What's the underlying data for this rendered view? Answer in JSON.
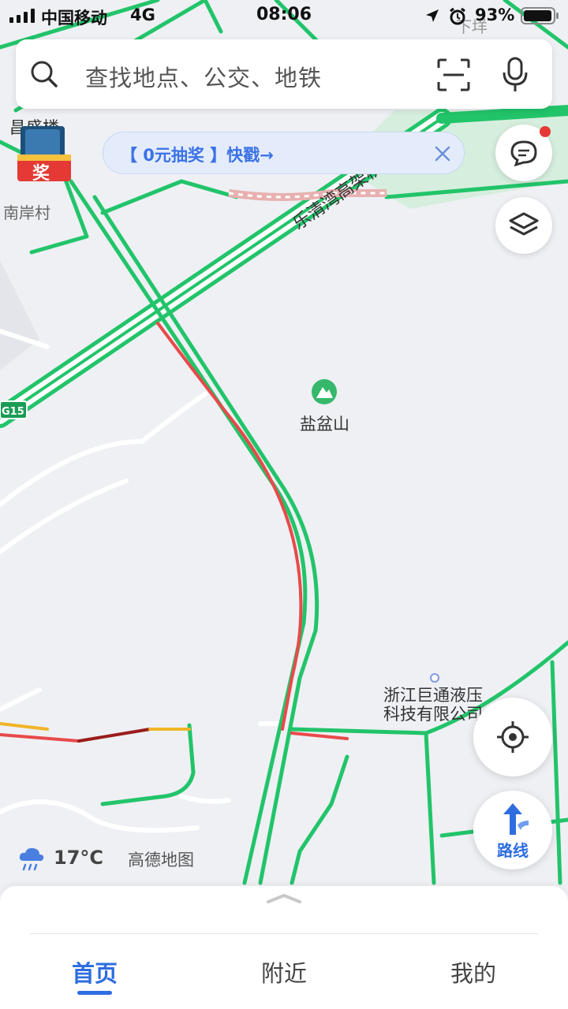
{
  "status_bar": {
    "carrier": "中国移动",
    "network": "4G",
    "time": "08:06",
    "battery": "93%"
  },
  "search": {
    "placeholder": "查找地点、公交、地铁"
  },
  "promo": {
    "text": "【 0元抽奖 】快戳→"
  },
  "map": {
    "labels": {
      "chang_sheng": "昌盛楼",
      "nan_an": "南岸村",
      "road_name": "乐清湾高架桥",
      "mountain": "盐盆山",
      "company_line1": "浙江巨通液压",
      "company_line2": "科技有限公司",
      "highway": "G15",
      "xia_zai": "下垟"
    }
  },
  "weather": {
    "temp": "17°C",
    "brand": "高德地图"
  },
  "route_button": {
    "label": "路线"
  },
  "tabs": [
    {
      "label": "首页"
    },
    {
      "label": "附近"
    },
    {
      "label": "我的"
    }
  ],
  "badge": {
    "label": "奖"
  },
  "colors": {
    "road_green": "#22c46a",
    "traffic_red": "#e84a4a",
    "traffic_yellow": "#f0b429",
    "traffic_dark_red": "#9b1c1c",
    "accent_blue": "#2d6de0",
    "notification_red": "#e53935"
  }
}
